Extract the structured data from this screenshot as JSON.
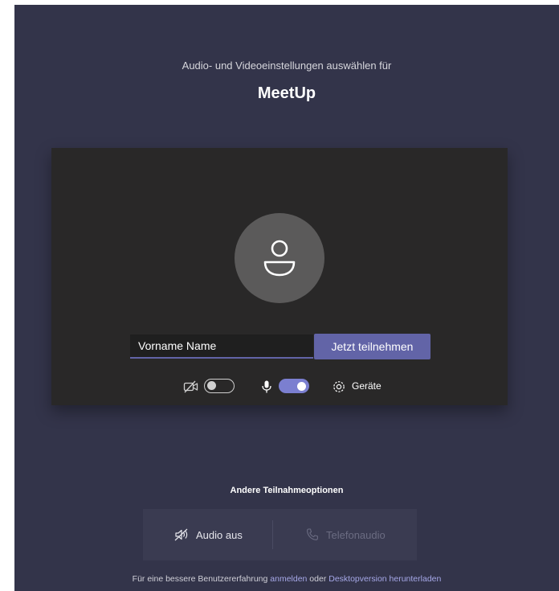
{
  "header": {
    "subtitle": "Audio- und Videoeinstellungen auswählen für",
    "meeting_title": "MeetUp"
  },
  "preview": {
    "name_input_value": "Vorname Name",
    "join_button_label": "Jetzt teilnehmen",
    "video_toggle_on": false,
    "mic_toggle_on": true,
    "devices_label": "Geräte"
  },
  "other_options": {
    "title": "Andere Teilnahmeoptionen",
    "audio_off_label": "Audio aus",
    "phone_audio_label": "Telefonaudio"
  },
  "footer": {
    "text_before": "Für eine bessere Benutzererfahrung ",
    "sign_in_link": "anmelden",
    "text_middle": " oder ",
    "desktop_link": "Desktopversion herunterladen"
  },
  "colors": {
    "background": "#33344a",
    "preview_panel": "#292828",
    "accent": "#6264a7",
    "link": "#a6a8e8"
  },
  "icons": {
    "avatar": "person-icon",
    "video": "video-off-icon",
    "microphone": "microphone-icon",
    "devices": "gear-icon",
    "audio_off": "speaker-off-icon",
    "phone": "phone-icon"
  }
}
